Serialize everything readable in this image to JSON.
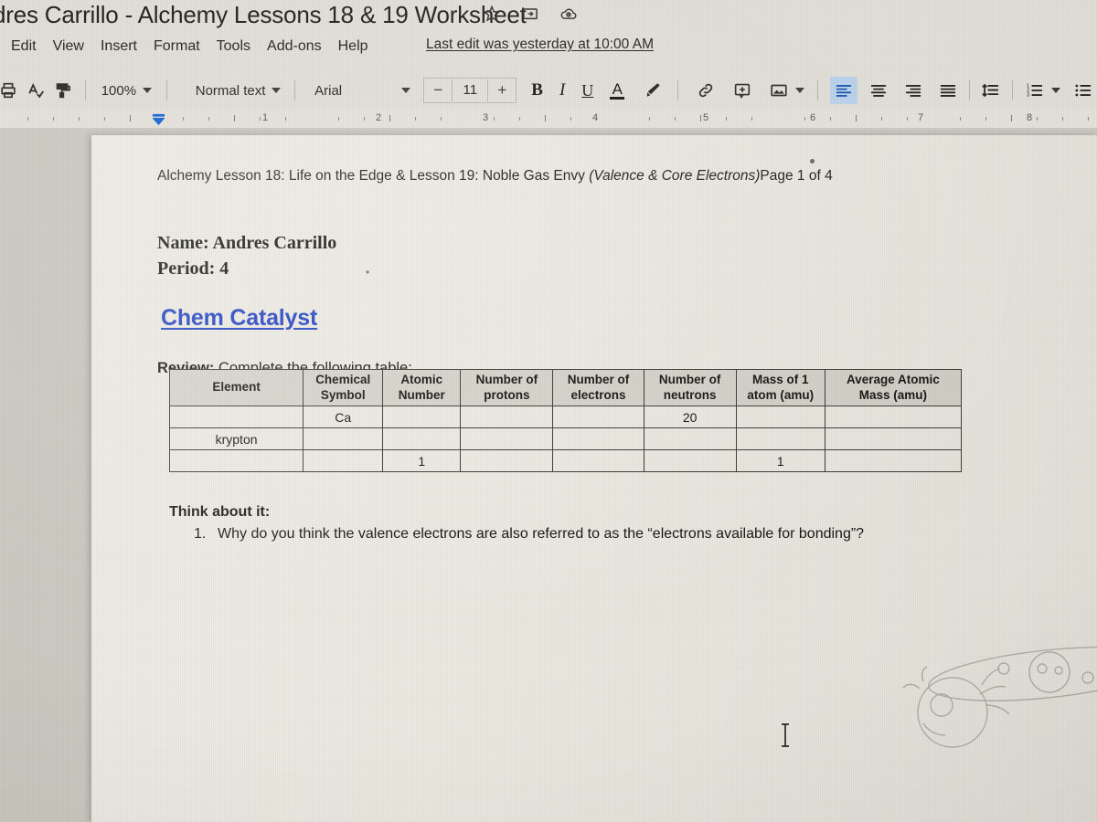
{
  "window": {
    "doc_title": "dres Carrillo - Alchemy Lessons 18 & 19 Worksheet",
    "title_icons": [
      {
        "name": "star-icon",
        "label": "Star"
      },
      {
        "name": "move-to-folder-icon",
        "label": "Move to folder"
      },
      {
        "name": "cloud-saved-icon",
        "label": "Saved to Drive"
      }
    ]
  },
  "menubar": {
    "items": [
      "Edit",
      "View",
      "Insert",
      "Format",
      "Tools",
      "Add-ons",
      "Help"
    ],
    "last_edit": "Last edit was yesterday at 10:00 AM"
  },
  "toolbar": {
    "print_icon": "print-icon",
    "spelling_icon": "spelling-check-icon",
    "paint_format_icon": "paint-format-icon",
    "zoom_value": "100%",
    "paragraph_style": "Normal text",
    "font_family": "Arial",
    "font_size_decrease": "−",
    "font_size": "11",
    "font_size_increase": "+",
    "bold_label": "B",
    "italic_label": "I",
    "underline_label": "U",
    "text_color_label": "A",
    "highlight_icon": "highlight-pen-icon",
    "link_icon": "insert-link-icon",
    "comment_icon": "add-comment-icon",
    "image_icon": "insert-image-icon",
    "align_left_icon": "align-left-icon",
    "align_center_icon": "align-center-icon",
    "align_right_icon": "align-right-icon",
    "align_justify_icon": "align-justify-icon",
    "line_spacing_icon": "line-spacing-icon",
    "numbered_list_icon": "numbered-list-icon",
    "bulleted_list_icon": "bulleted-list-icon",
    "active_alignment": "align-left"
  },
  "ruler": {
    "numbers": [
      "1",
      "2",
      "3",
      "4",
      "5",
      "6",
      "7",
      "8"
    ],
    "indent_marker": "left-indent-marker"
  },
  "document": {
    "header_plain_1": "Alchemy Lesson 18: Life on the Edge & Lesson 19: Noble Gas Envy ",
    "header_italic": "(Valence & Core Electrons)",
    "header_plain_2": "Page 1 of 4",
    "name_line": "Name: Andres Carrillo",
    "period_line": "Period: 4",
    "section_heading": "Chem Catalyst",
    "review_bold": "Review:",
    "review_rest": " Complete the following table:",
    "think_heading": "Think about it:",
    "question_number": "1.",
    "question_text": "Why do you think the valence electrons are also referred to as the “electrons available for bonding”?",
    "heading_color": "#1f41c4"
  },
  "table": {
    "headers": [
      "Element",
      "Chemical Symbol",
      "Atomic Number",
      "Number of protons",
      "Number of electrons",
      "Number of neutrons",
      "Mass of 1 atom (amu)",
      "Average Atomic Mass (amu)"
    ],
    "header_lines": [
      [
        "Element",
        ""
      ],
      [
        "Chemical",
        "Symbol"
      ],
      [
        "Atomic",
        "Number"
      ],
      [
        "Number of",
        "protons"
      ],
      [
        "Number of",
        "electrons"
      ],
      [
        "Number of",
        "neutrons"
      ],
      [
        "Mass of 1",
        "atom (amu)"
      ],
      [
        "Average Atomic",
        "Mass (amu)"
      ]
    ],
    "rows": [
      [
        "",
        "Ca",
        "",
        "",
        "",
        "20",
        "",
        ""
      ],
      [
        "krypton",
        "",
        "",
        "",
        "",
        "",
        "",
        ""
      ],
      [
        "",
        "",
        "1",
        "",
        "",
        "",
        "1",
        ""
      ]
    ]
  }
}
